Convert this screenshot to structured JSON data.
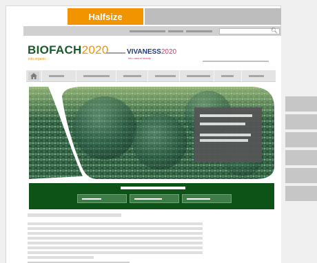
{
  "tabs": {
    "active_label": "Halfsize",
    "inactive_label": ""
  },
  "header": {
    "biofach_name": "BIOFACH",
    "biofach_year": "2020",
    "biofach_tagline": "into organic",
    "vivaness_name": "VIVANESS",
    "vivaness_year": "2020",
    "vivaness_tagline": "into natural beauty"
  },
  "search": {
    "placeholder": "",
    "icon": "search-icon"
  },
  "nav": {
    "home_icon": "home-icon",
    "item_count": 7
  },
  "hero": {
    "image": "broccoli-photo",
    "info_lines": 4
  },
  "promo_band": {
    "button_count": 3
  },
  "side_buttons": {
    "count": 6
  },
  "colors": {
    "accent_orange": "#f29400",
    "brand_green": "#0d5216",
    "vivaness_blue": "#1e3a7a",
    "vivaness_pink": "#d8336c"
  }
}
